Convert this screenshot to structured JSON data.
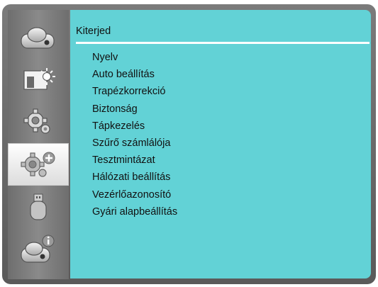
{
  "sidebar": {
    "items": [
      {
        "icon": "projector-icon",
        "selected": false
      },
      {
        "icon": "image-brightness-icon",
        "selected": false
      },
      {
        "icon": "gear-icon",
        "selected": false
      },
      {
        "icon": "gear-plus-icon",
        "selected": true
      },
      {
        "icon": "usb-icon",
        "selected": false
      },
      {
        "icon": "projector-info-icon",
        "selected": false
      }
    ]
  },
  "panel": {
    "title": "Kiterjed",
    "items": [
      "Nyelv",
      "Auto beállítás",
      "Trapézkorrekció",
      "Biztonság",
      "Tápkezelés",
      "Szűrő számlálója",
      "Tesztmintázat",
      "Hálózati beállítás",
      "Vezérlőazonosító",
      "Gyári alapbeállítás"
    ]
  },
  "colors": {
    "panel_bg": "#62d2d6",
    "frame_bg": "#6a6a6a",
    "selected_bg": "#ffffff"
  }
}
